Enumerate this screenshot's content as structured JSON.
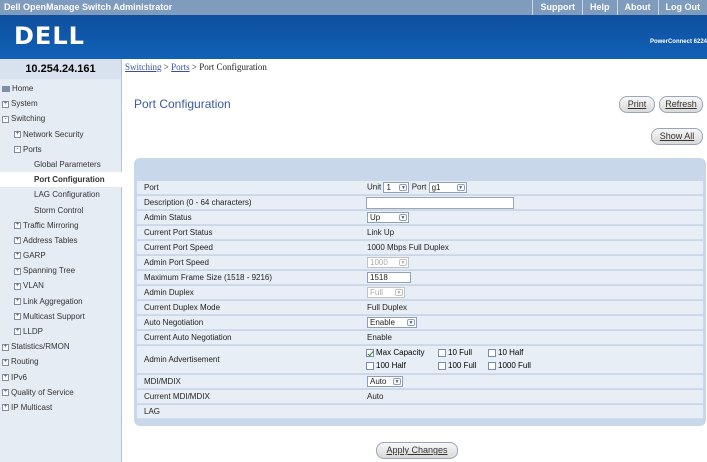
{
  "app": {
    "title": "Dell OpenManage Switch Administrator",
    "top_links": [
      "Support",
      "Help",
      "About",
      "Log Out"
    ],
    "logo": "DELL",
    "product": "PowerConnect 6224"
  },
  "nav": {
    "ip": "10.254.24.161",
    "items": [
      {
        "label": "Home",
        "expander": ""
      },
      {
        "label": "System",
        "expander": "+"
      },
      {
        "label": "Switching",
        "expander": "-"
      },
      {
        "label": "Network Security",
        "expander": "+"
      },
      {
        "label": "Ports",
        "expander": "-"
      },
      {
        "label": "Global Parameters",
        "expander": ""
      },
      {
        "label": "Port Configuration",
        "expander": ""
      },
      {
        "label": "LAG Configuration",
        "expander": ""
      },
      {
        "label": "Storm Control",
        "expander": ""
      },
      {
        "label": "Traffic Mirroring",
        "expander": "+"
      },
      {
        "label": "Address Tables",
        "expander": "+"
      },
      {
        "label": "GARP",
        "expander": "+"
      },
      {
        "label": "Spanning Tree",
        "expander": "+"
      },
      {
        "label": "VLAN",
        "expander": "+"
      },
      {
        "label": "Link Aggregation",
        "expander": "+"
      },
      {
        "label": "Multicast Support",
        "expander": "+"
      },
      {
        "label": "LLDP",
        "expander": "+"
      },
      {
        "label": "Statistics/RMON",
        "expander": "+"
      },
      {
        "label": "Routing",
        "expander": "+"
      },
      {
        "label": "IPv6",
        "expander": "+"
      },
      {
        "label": "Quality of Service",
        "expander": "+"
      },
      {
        "label": "IP Multicast",
        "expander": "+"
      }
    ]
  },
  "breadcrumb": {
    "part1": "Switching",
    "sep1": " > ",
    "part2": "Ports",
    "sep2": " > ",
    "part3": "Port Configuration"
  },
  "page": {
    "title": "Port Configuration",
    "print": "Print",
    "refresh": "Refresh",
    "show_all": "Show All",
    "apply": "Apply Changes"
  },
  "form": {
    "port": {
      "label": "Port",
      "unit_label": "Unit",
      "unit_value": "1",
      "port_label": "Port",
      "port_value": "g1"
    },
    "description": {
      "label": "Description (0 - 64 characters)",
      "value": ""
    },
    "admin_status": {
      "label": "Admin Status",
      "value": "Up"
    },
    "current_port_status": {
      "label": "Current Port Status",
      "value": "Link Up"
    },
    "current_port_speed": {
      "label": "Current Port Speed",
      "value": "1000 Mbps Full Duplex"
    },
    "admin_port_speed": {
      "label": "Admin Port Speed",
      "value": "1000"
    },
    "max_frame": {
      "label": "Maximum Frame Size (1518 - 9216)",
      "value": "1518"
    },
    "admin_duplex": {
      "label": "Admin Duplex",
      "value": "Full"
    },
    "current_duplex": {
      "label": "Current Duplex Mode",
      "value": "Full Duplex"
    },
    "auto_negotiation": {
      "label": "Auto Negotiation",
      "value": "Enable"
    },
    "current_auto_negotiation": {
      "label": "Current Auto Negotiation",
      "value": "Enable"
    },
    "admin_advertisement": {
      "label": "Admin Advertisement",
      "options": [
        "Max Capacity",
        "10 Full",
        "10 Half",
        "100 Half",
        "100 Full",
        "1000 Full"
      ]
    },
    "mdi": {
      "label": "MDI/MDIX",
      "value": "Auto"
    },
    "current_mdi": {
      "label": "Current MDI/MDIX",
      "value": "Auto"
    },
    "lag": {
      "label": "LAG",
      "value": ""
    }
  }
}
